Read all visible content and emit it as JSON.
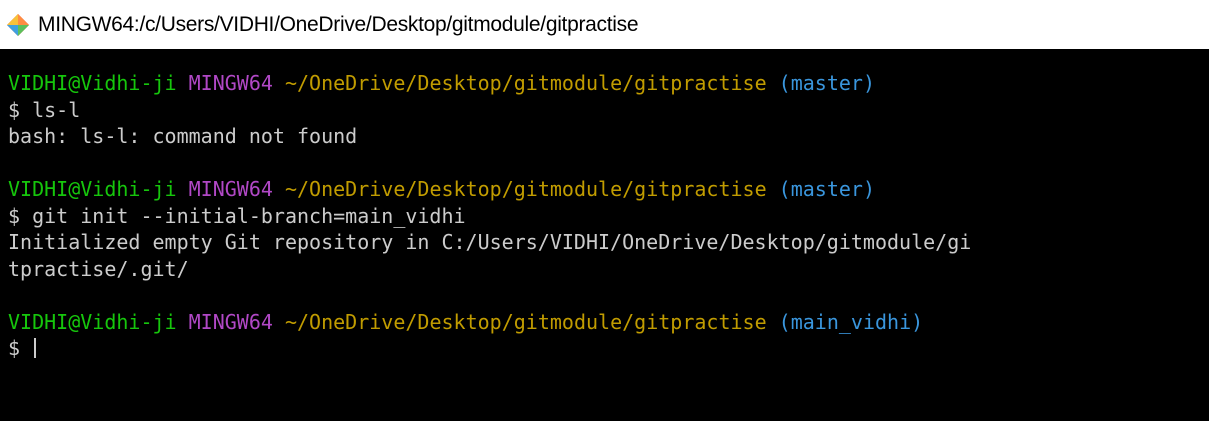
{
  "window": {
    "title": "MINGW64:/c/Users/VIDHI/OneDrive/Desktop/gitmodule/gitpractise",
    "icon": "git-bash-icon"
  },
  "colors": {
    "user": "#16c60c",
    "host": "#b148c6",
    "path": "#c19c00",
    "branch": "#3a96dd",
    "text": "#cccccc",
    "background": "#000000"
  },
  "blocks": [
    {
      "prompt": {
        "user": "VIDHI@Vidhi-ji",
        "host": "MINGW64",
        "path": "~/OneDrive/Desktop/gitmodule/gitpractise",
        "branch": "(master)"
      },
      "command": "$ ls-l",
      "output": [
        "bash: ls-l: command not found"
      ]
    },
    {
      "prompt": {
        "user": "VIDHI@Vidhi-ji",
        "host": "MINGW64",
        "path": "~/OneDrive/Desktop/gitmodule/gitpractise",
        "branch": "(master)"
      },
      "command": "$ git init --initial-branch=main_vidhi",
      "output": [
        "Initialized empty Git repository in C:/Users/VIDHI/OneDrive/Desktop/gitmodule/gi",
        "tpractise/.git/"
      ]
    },
    {
      "prompt": {
        "user": "VIDHI@Vidhi-ji",
        "host": "MINGW64",
        "path": "~/OneDrive/Desktop/gitmodule/gitpractise",
        "branch": "(main_vidhi)"
      },
      "command": "$ ",
      "output": []
    }
  ]
}
